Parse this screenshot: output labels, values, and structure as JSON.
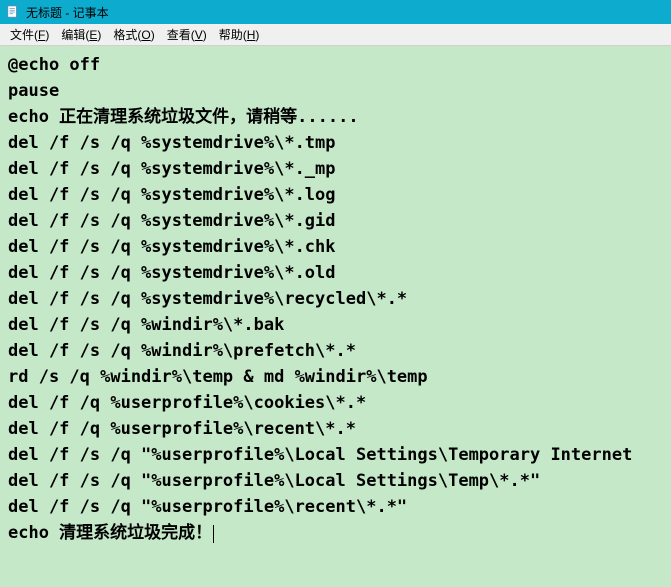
{
  "window": {
    "title": "无标题 - 记事本"
  },
  "menubar": {
    "file": "文件(F)",
    "edit": "编辑(E)",
    "format": "格式(O)",
    "view": "查看(V)",
    "help": "帮助(H)"
  },
  "content": {
    "lines": [
      "@echo off",
      "pause",
      "echo 正在清理系统垃圾文件，请稍等......",
      "del /f /s /q %systemdrive%\\*.tmp",
      "del /f /s /q %systemdrive%\\*._mp",
      "del /f /s /q %systemdrive%\\*.log",
      "del /f /s /q %systemdrive%\\*.gid",
      "del /f /s /q %systemdrive%\\*.chk",
      "del /f /s /q %systemdrive%\\*.old",
      "del /f /s /q %systemdrive%\\recycled\\*.*",
      "del /f /s /q %windir%\\*.bak",
      "del /f /s /q %windir%\\prefetch\\*.*",
      "rd /s /q %windir%\\temp & md %windir%\\temp",
      "del /f /q %userprofile%\\cookies\\*.*",
      "del /f /q %userprofile%\\recent\\*.*",
      "del /f /s /q \"%userprofile%\\Local Settings\\Temporary Internet",
      "del /f /s /q \"%userprofile%\\Local Settings\\Temp\\*.*\"",
      "del /f /s /q \"%userprofile%\\recent\\*.*\"",
      "echo 清理系统垃圾完成！"
    ]
  },
  "colors": {
    "titlebar": "#0dabce",
    "content_bg": "#c5e8c9"
  }
}
